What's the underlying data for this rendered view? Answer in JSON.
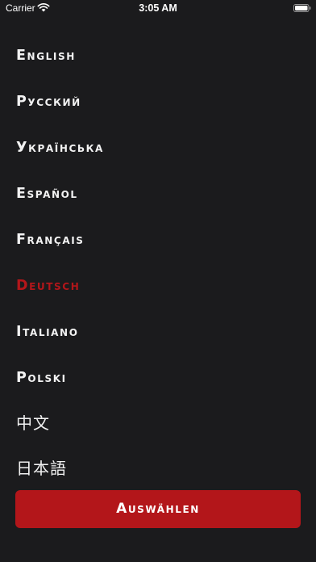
{
  "status_bar": {
    "carrier": "Carrier",
    "time": "3:05 AM",
    "wifi_icon": "wifi-icon",
    "battery_icon": "battery-icon"
  },
  "languages": {
    "selected_index": 5,
    "items": [
      {
        "label": "English"
      },
      {
        "label": "Русский"
      },
      {
        "label": "Українська"
      },
      {
        "label": "Español"
      },
      {
        "label": "Français"
      },
      {
        "label": "Deutsch"
      },
      {
        "label": "Italiano"
      },
      {
        "label": "Polski"
      },
      {
        "label": "中文"
      },
      {
        "label": "日本語"
      }
    ]
  },
  "confirm_button": {
    "label": "Auswählen"
  },
  "colors": {
    "background": "#1b1b1d",
    "accent": "#b3161a",
    "text": "#f2f2f2"
  }
}
